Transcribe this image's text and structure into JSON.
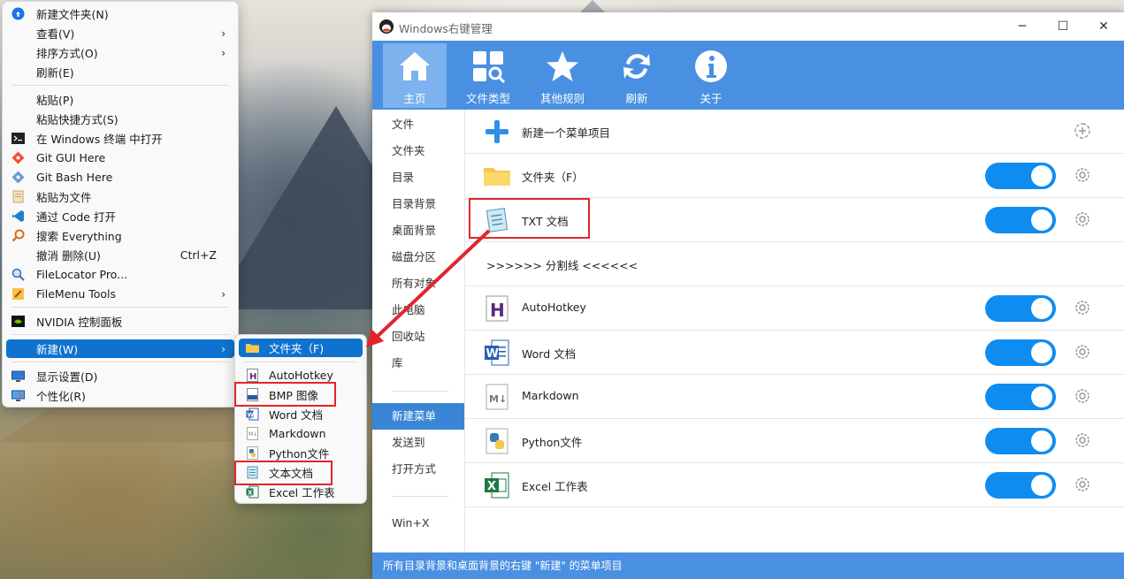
{
  "context_menu": {
    "items": [
      {
        "label": "新建文件夹(N)"
      },
      {
        "label": "查看(V)"
      },
      {
        "label": "排序方式(O)"
      },
      {
        "label": "刷新(E)"
      },
      {
        "label": "粘贴(P)"
      },
      {
        "label": "粘贴快捷方式(S)"
      },
      {
        "label": "在 Windows 终端 中打开"
      },
      {
        "label": "Git GUI Here"
      },
      {
        "label": "Git Bash Here"
      },
      {
        "label": "粘贴为文件"
      },
      {
        "label": "通过 Code 打开"
      },
      {
        "label": "搜索 Everything"
      },
      {
        "label": "撤消 删除(U)",
        "shortcut": "Ctrl+Z"
      },
      {
        "label": "FileLocator Pro..."
      },
      {
        "label": "FileMenu Tools"
      },
      {
        "label": "NVIDIA 控制面板"
      },
      {
        "label": "新建(W)"
      },
      {
        "label": "显示设置(D)"
      },
      {
        "label": "个性化(R)"
      }
    ]
  },
  "submenu": {
    "items": [
      {
        "label": "文件夹（F)"
      },
      {
        "label": "AutoHotkey"
      },
      {
        "label": "BMP 图像"
      },
      {
        "label": "Word 文档"
      },
      {
        "label": "Markdown"
      },
      {
        "label": "Python文件"
      },
      {
        "label": "文本文档"
      },
      {
        "label": "Excel 工作表"
      }
    ]
  },
  "window": {
    "title": "Windows右键管理",
    "toolbar": [
      "主页",
      "文件类型",
      "其他规则",
      "刷新",
      "关于"
    ],
    "sidebar": [
      "文件",
      "文件夹",
      "目录",
      "目录背景",
      "桌面背景",
      "磁盘分区",
      "所有对象",
      "此电脑",
      "回收站",
      "库",
      "新建菜单",
      "发送到",
      "打开方式",
      "Win+X"
    ],
    "add_item_label": "新建一个菜单项目",
    "rows": [
      {
        "label": "文件夹（F）"
      },
      {
        "label": "TXT 文档"
      },
      {
        "label": ">>>>>> 分割线 <<<<<<"
      },
      {
        "label": "AutoHotkey"
      },
      {
        "label": "Word 文档"
      },
      {
        "label": "Markdown"
      },
      {
        "label": "Python文件"
      },
      {
        "label": "Excel 工作表"
      }
    ],
    "status": "所有目录背景和桌面背景的右键 \"新建\" 的菜单项目"
  },
  "colors": {
    "accent": "#4a90e2",
    "toggle": "#0f8cf0",
    "highlight": "#0f72cf",
    "annotation": "#e0262d"
  }
}
